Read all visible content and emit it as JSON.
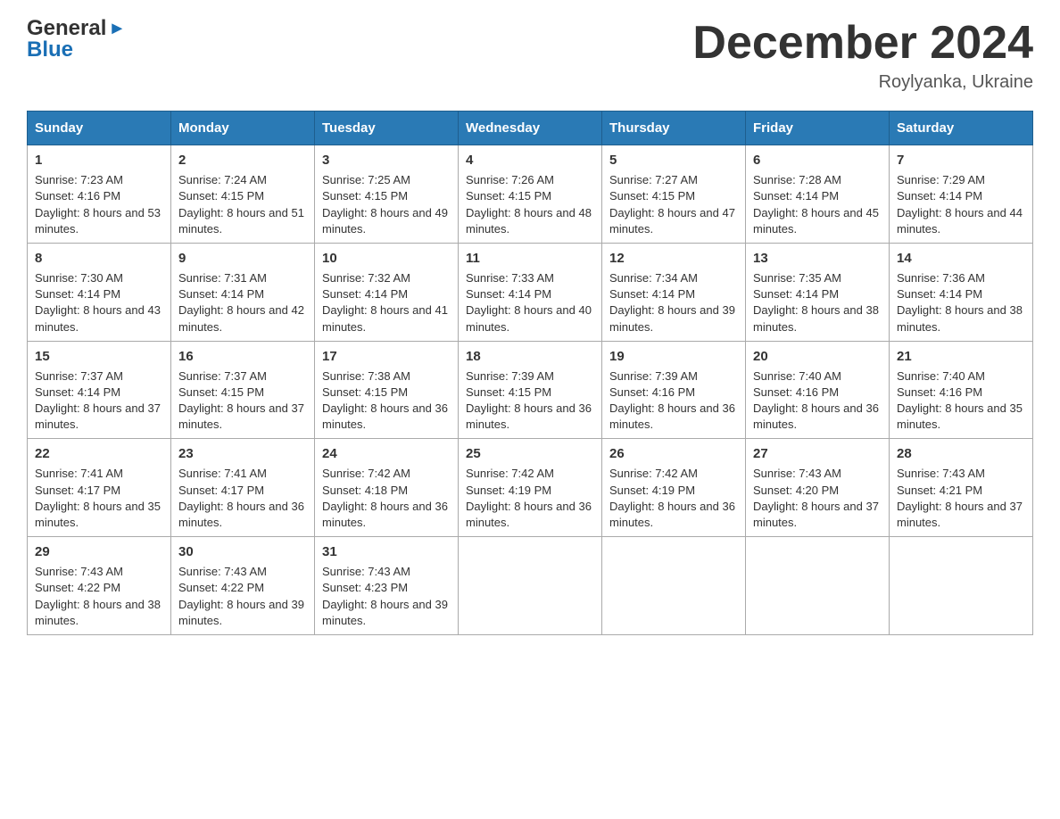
{
  "header": {
    "logo_line1": "General",
    "logo_line2": "Blue",
    "month_title": "December 2024",
    "location": "Roylyanka, Ukraine"
  },
  "weekdays": [
    "Sunday",
    "Monday",
    "Tuesday",
    "Wednesday",
    "Thursday",
    "Friday",
    "Saturday"
  ],
  "weeks": [
    [
      {
        "day": "1",
        "sunrise": "7:23 AM",
        "sunset": "4:16 PM",
        "daylight": "8 hours and 53 minutes."
      },
      {
        "day": "2",
        "sunrise": "7:24 AM",
        "sunset": "4:15 PM",
        "daylight": "8 hours and 51 minutes."
      },
      {
        "day": "3",
        "sunrise": "7:25 AM",
        "sunset": "4:15 PM",
        "daylight": "8 hours and 49 minutes."
      },
      {
        "day": "4",
        "sunrise": "7:26 AM",
        "sunset": "4:15 PM",
        "daylight": "8 hours and 48 minutes."
      },
      {
        "day": "5",
        "sunrise": "7:27 AM",
        "sunset": "4:15 PM",
        "daylight": "8 hours and 47 minutes."
      },
      {
        "day": "6",
        "sunrise": "7:28 AM",
        "sunset": "4:14 PM",
        "daylight": "8 hours and 45 minutes."
      },
      {
        "day": "7",
        "sunrise": "7:29 AM",
        "sunset": "4:14 PM",
        "daylight": "8 hours and 44 minutes."
      }
    ],
    [
      {
        "day": "8",
        "sunrise": "7:30 AM",
        "sunset": "4:14 PM",
        "daylight": "8 hours and 43 minutes."
      },
      {
        "day": "9",
        "sunrise": "7:31 AM",
        "sunset": "4:14 PM",
        "daylight": "8 hours and 42 minutes."
      },
      {
        "day": "10",
        "sunrise": "7:32 AM",
        "sunset": "4:14 PM",
        "daylight": "8 hours and 41 minutes."
      },
      {
        "day": "11",
        "sunrise": "7:33 AM",
        "sunset": "4:14 PM",
        "daylight": "8 hours and 40 minutes."
      },
      {
        "day": "12",
        "sunrise": "7:34 AM",
        "sunset": "4:14 PM",
        "daylight": "8 hours and 39 minutes."
      },
      {
        "day": "13",
        "sunrise": "7:35 AM",
        "sunset": "4:14 PM",
        "daylight": "8 hours and 38 minutes."
      },
      {
        "day": "14",
        "sunrise": "7:36 AM",
        "sunset": "4:14 PM",
        "daylight": "8 hours and 38 minutes."
      }
    ],
    [
      {
        "day": "15",
        "sunrise": "7:37 AM",
        "sunset": "4:14 PM",
        "daylight": "8 hours and 37 minutes."
      },
      {
        "day": "16",
        "sunrise": "7:37 AM",
        "sunset": "4:15 PM",
        "daylight": "8 hours and 37 minutes."
      },
      {
        "day": "17",
        "sunrise": "7:38 AM",
        "sunset": "4:15 PM",
        "daylight": "8 hours and 36 minutes."
      },
      {
        "day": "18",
        "sunrise": "7:39 AM",
        "sunset": "4:15 PM",
        "daylight": "8 hours and 36 minutes."
      },
      {
        "day": "19",
        "sunrise": "7:39 AM",
        "sunset": "4:16 PM",
        "daylight": "8 hours and 36 minutes."
      },
      {
        "day": "20",
        "sunrise": "7:40 AM",
        "sunset": "4:16 PM",
        "daylight": "8 hours and 36 minutes."
      },
      {
        "day": "21",
        "sunrise": "7:40 AM",
        "sunset": "4:16 PM",
        "daylight": "8 hours and 35 minutes."
      }
    ],
    [
      {
        "day": "22",
        "sunrise": "7:41 AM",
        "sunset": "4:17 PM",
        "daylight": "8 hours and 35 minutes."
      },
      {
        "day": "23",
        "sunrise": "7:41 AM",
        "sunset": "4:17 PM",
        "daylight": "8 hours and 36 minutes."
      },
      {
        "day": "24",
        "sunrise": "7:42 AM",
        "sunset": "4:18 PM",
        "daylight": "8 hours and 36 minutes."
      },
      {
        "day": "25",
        "sunrise": "7:42 AM",
        "sunset": "4:19 PM",
        "daylight": "8 hours and 36 minutes."
      },
      {
        "day": "26",
        "sunrise": "7:42 AM",
        "sunset": "4:19 PM",
        "daylight": "8 hours and 36 minutes."
      },
      {
        "day": "27",
        "sunrise": "7:43 AM",
        "sunset": "4:20 PM",
        "daylight": "8 hours and 37 minutes."
      },
      {
        "day": "28",
        "sunrise": "7:43 AM",
        "sunset": "4:21 PM",
        "daylight": "8 hours and 37 minutes."
      }
    ],
    [
      {
        "day": "29",
        "sunrise": "7:43 AM",
        "sunset": "4:22 PM",
        "daylight": "8 hours and 38 minutes."
      },
      {
        "day": "30",
        "sunrise": "7:43 AM",
        "sunset": "4:22 PM",
        "daylight": "8 hours and 39 minutes."
      },
      {
        "day": "31",
        "sunrise": "7:43 AM",
        "sunset": "4:23 PM",
        "daylight": "8 hours and 39 minutes."
      },
      null,
      null,
      null,
      null
    ]
  ]
}
